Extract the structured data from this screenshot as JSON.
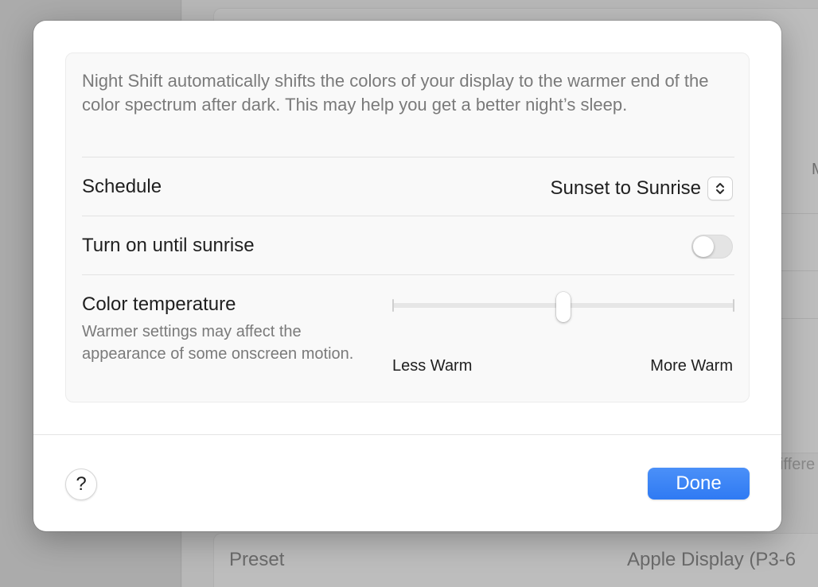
{
  "background": {
    "peek_top_right": "M",
    "peek_bottom_right": "iffere",
    "preset_label": "Preset",
    "preset_value": "Apple Display (P3-6"
  },
  "night_shift": {
    "description": "Night Shift automatically shifts the colors of your display to the warmer end of the color spectrum after dark. This may help you get a better night’s sleep.",
    "schedule": {
      "label": "Schedule",
      "value": "Sunset to Sunrise"
    },
    "turn_on": {
      "label": "Turn on until sunrise",
      "enabled": false
    },
    "color_temperature": {
      "label": "Color temperature",
      "sublabel": "Warmer settings may affect the appearance of some onscreen motion.",
      "min_label": "Less Warm",
      "max_label": "More Warm",
      "value": 0.5
    }
  },
  "footer": {
    "help_label": "?",
    "done_label": "Done"
  },
  "colors": {
    "accent": "#3b82f6"
  }
}
